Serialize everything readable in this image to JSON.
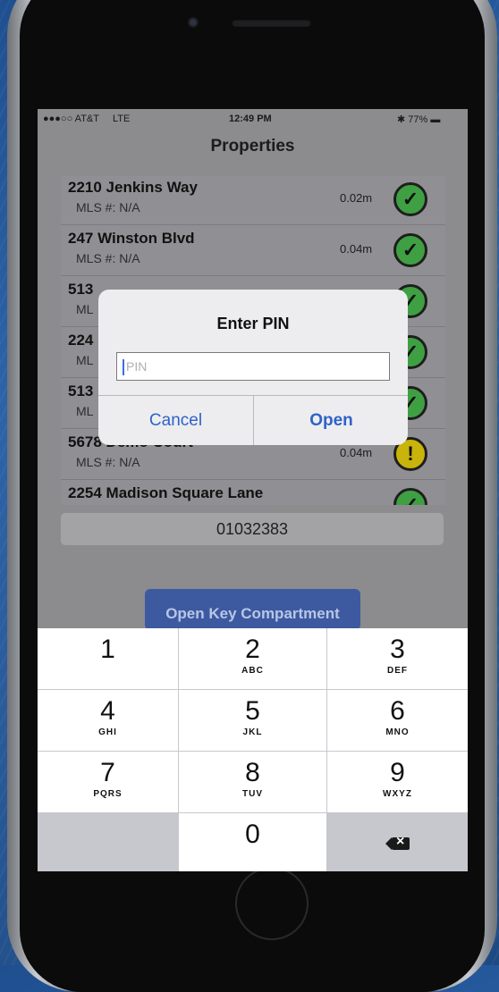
{
  "status_bar": {
    "carrier": "●●●○○ AT&T",
    "network": "LTE",
    "time": "12:49 PM",
    "battery": "✱ 77% ▬"
  },
  "nav": {
    "title": "Properties"
  },
  "properties": [
    {
      "name": "2210 Jenkins Way",
      "mls": "MLS #: N/A",
      "distance": "0.02m",
      "status_icon": "check-circle-icon",
      "status_glyph": "✓"
    },
    {
      "name": "247 Winston Blvd",
      "mls": "MLS #: N/A",
      "distance": "0.04m",
      "status_icon": "check-circle-icon",
      "status_glyph": "✓"
    },
    {
      "name": "513",
      "mls": "ML",
      "distance": "",
      "status_icon": "check-circle-icon",
      "status_glyph": "✓"
    },
    {
      "name": "224",
      "mls": "ML",
      "distance": "",
      "status_icon": "check-circle-icon",
      "status_glyph": "✓"
    },
    {
      "name": "513",
      "mls": "ML",
      "distance": "",
      "status_icon": "check-circle-icon",
      "status_glyph": "✓"
    },
    {
      "name": "5678 Demo Court",
      "mls": "MLS #: N/A",
      "distance": "0.04m",
      "status_icon": "warning-circle-icon",
      "status_glyph": "!"
    },
    {
      "name": "2254 Madison Square Lane",
      "mls": "",
      "distance": "",
      "status_icon": "check-circle-icon",
      "status_glyph": "✓"
    }
  ],
  "lockbox_id": "01032383",
  "open_key_button": "Open Key Compartment",
  "dialog": {
    "title": "Enter PIN",
    "placeholder": "PIN",
    "cancel": "Cancel",
    "open": "Open"
  },
  "keypad": [
    {
      "digit": "1",
      "letters": ""
    },
    {
      "digit": "2",
      "letters": "ABC"
    },
    {
      "digit": "3",
      "letters": "DEF"
    },
    {
      "digit": "4",
      "letters": "GHI"
    },
    {
      "digit": "5",
      "letters": "JKL"
    },
    {
      "digit": "6",
      "letters": "MNO"
    },
    {
      "digit": "7",
      "letters": "PQRS"
    },
    {
      "digit": "8",
      "letters": "TUV"
    },
    {
      "digit": "9",
      "letters": "WXYZ"
    },
    {
      "digit": "0",
      "letters": ""
    }
  ]
}
